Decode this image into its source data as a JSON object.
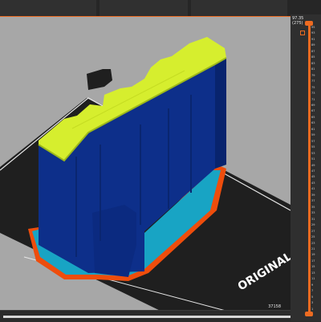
{
  "colors": {
    "background": "#2b2b2b",
    "bed": "#a7a7a7",
    "bed_dark": "#1b1b1b",
    "model_blue": "#0d2f8a",
    "model_top": "#d6ee2e",
    "skirt_orange": "#ee4d0c",
    "support_cyan": "#18a4c4",
    "accent": "#ed6b21"
  },
  "viewport": {
    "bed_label": "ORIGINAL P"
  },
  "layer_slider": {
    "top_value": "97.35",
    "top_layer": "(275)",
    "tick_values": [
      "95",
      "93",
      "91",
      "89",
      "87",
      "85",
      "83",
      "81",
      "79",
      "77",
      "75",
      "73",
      "71",
      "69",
      "67",
      "65",
      "63",
      "61",
      "59",
      "57",
      "55",
      "53",
      "51",
      "49",
      "47",
      "45",
      "43",
      "41",
      "39",
      "37",
      "35",
      "33",
      "31",
      "29",
      "27",
      "25",
      "23",
      "21",
      "19",
      "17",
      "15",
      "13",
      "11",
      "9",
      "7",
      "5",
      "3",
      "1"
    ]
  },
  "move_slider": {
    "value": "37158"
  }
}
